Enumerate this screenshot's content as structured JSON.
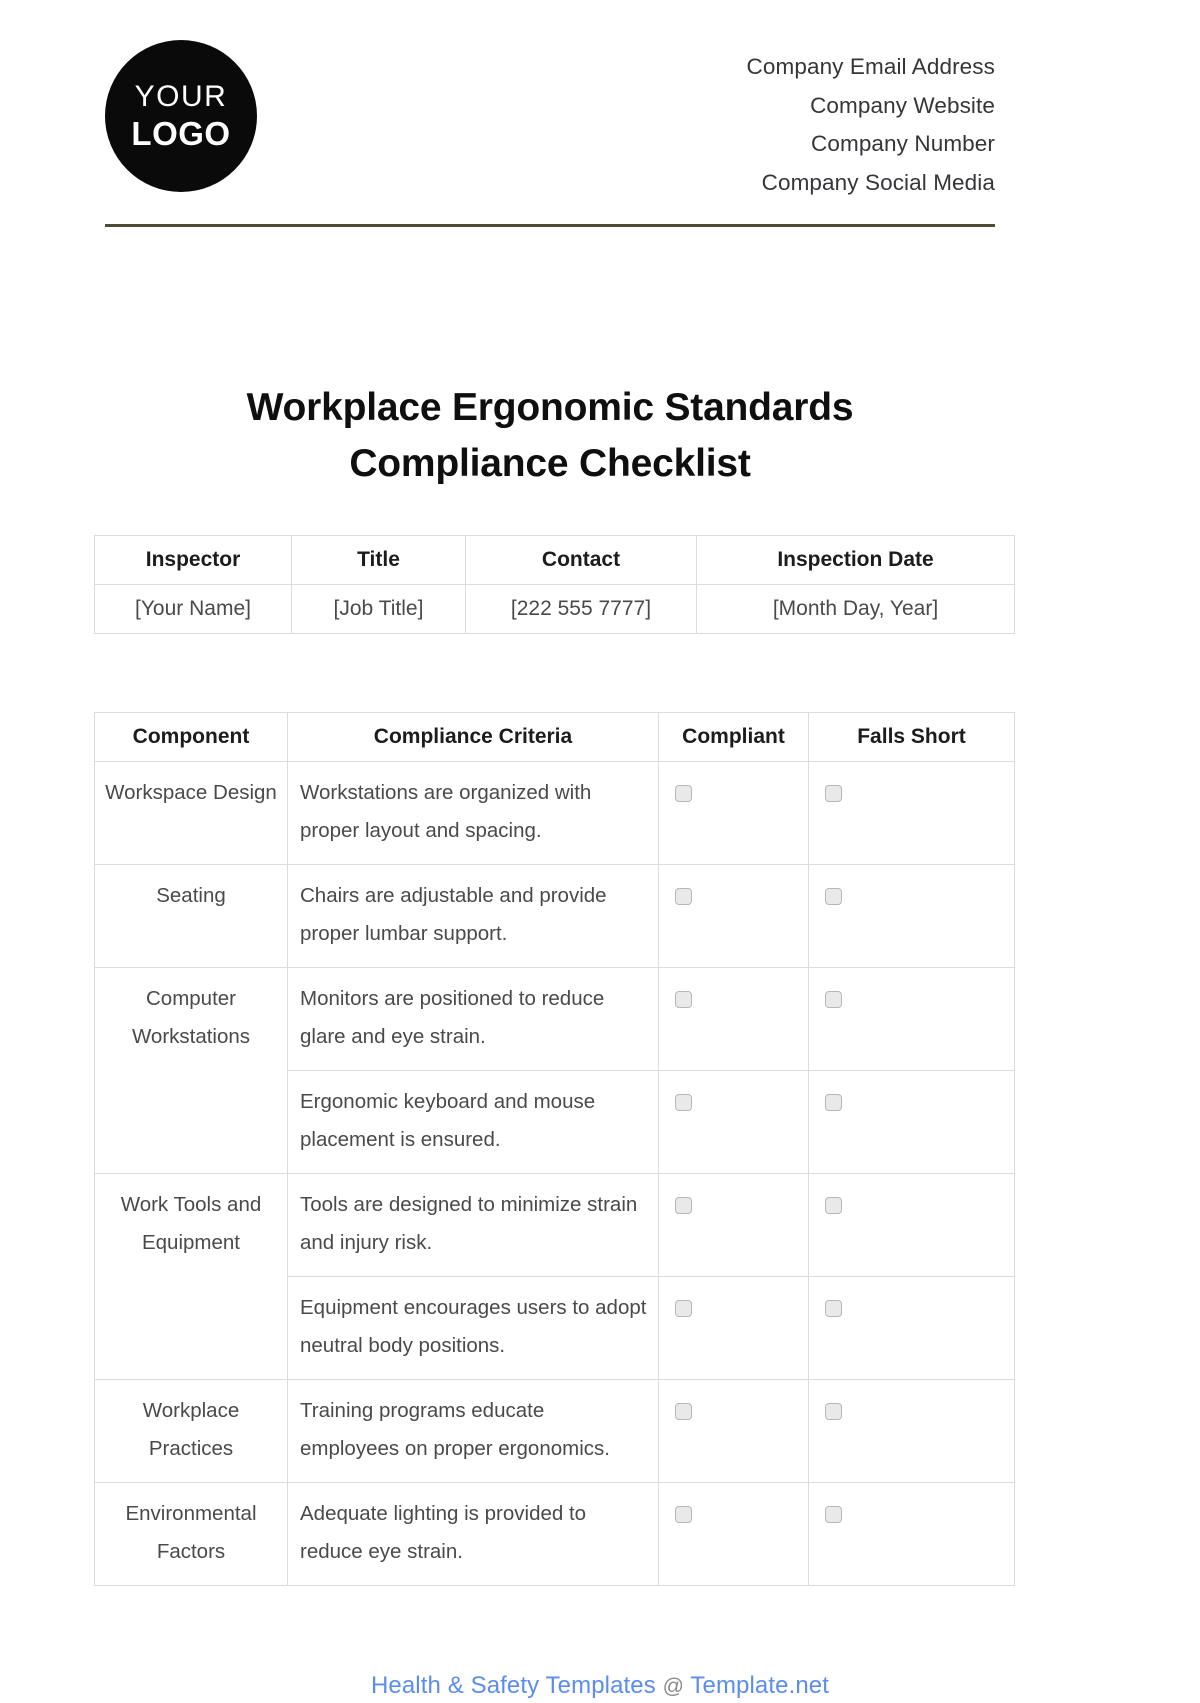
{
  "header": {
    "logo": {
      "line1": "YOUR",
      "line2": "LOGO"
    },
    "company": [
      "Company Email Address",
      "Company Website",
      "Company Number",
      "Company Social Media"
    ],
    "rule_color": "#4c4c38"
  },
  "title": "Workplace Ergonomic Standards Compliance Checklist",
  "info_table": {
    "headers": [
      "Inspector",
      "Title",
      "Contact",
      "Inspection Date"
    ],
    "values": [
      "[Your Name]",
      "[Job Title]",
      "[222 555 7777]",
      "[Month Day, Year]"
    ]
  },
  "checklist": {
    "headers": [
      "Component",
      "Compliance Criteria",
      "Compliant",
      "Falls Short"
    ],
    "rows": [
      {
        "component": "Workspace Design",
        "criteria": "Workstations are organized with proper layout and spacing.",
        "compliant": false,
        "falls_short": false,
        "merge": "none"
      },
      {
        "component": "Seating",
        "criteria": "Chairs are adjustable and provide proper lumbar support.",
        "compliant": false,
        "falls_short": false,
        "merge": "none"
      },
      {
        "component": "Computer Workstations",
        "criteria": "Monitors are positioned to reduce glare and eye strain.",
        "compliant": false,
        "falls_short": false,
        "merge": "top"
      },
      {
        "component": "",
        "criteria": "Ergonomic keyboard and mouse placement is ensured.",
        "compliant": false,
        "falls_short": false,
        "merge": "bottom"
      },
      {
        "component": "Work Tools and Equipment",
        "criteria": "Tools are designed to minimize strain and injury risk.",
        "compliant": false,
        "falls_short": false,
        "merge": "top"
      },
      {
        "component": "",
        "criteria": "Equipment encourages users to adopt neutral body positions.",
        "compliant": false,
        "falls_short": false,
        "merge": "bottom"
      },
      {
        "component": "Workplace Practices",
        "criteria": "Training programs educate employees on proper ergonomics.",
        "compliant": false,
        "falls_short": false,
        "merge": "none"
      },
      {
        "component": "Environmental Factors",
        "criteria": "Adequate lighting is provided to reduce eye strain.",
        "compliant": false,
        "falls_short": false,
        "merge": "none"
      }
    ]
  },
  "footer": {
    "prefix": "Health & Safety Templates",
    "at": "@",
    "suffix": "Template.net",
    "color": "#5b8def"
  }
}
